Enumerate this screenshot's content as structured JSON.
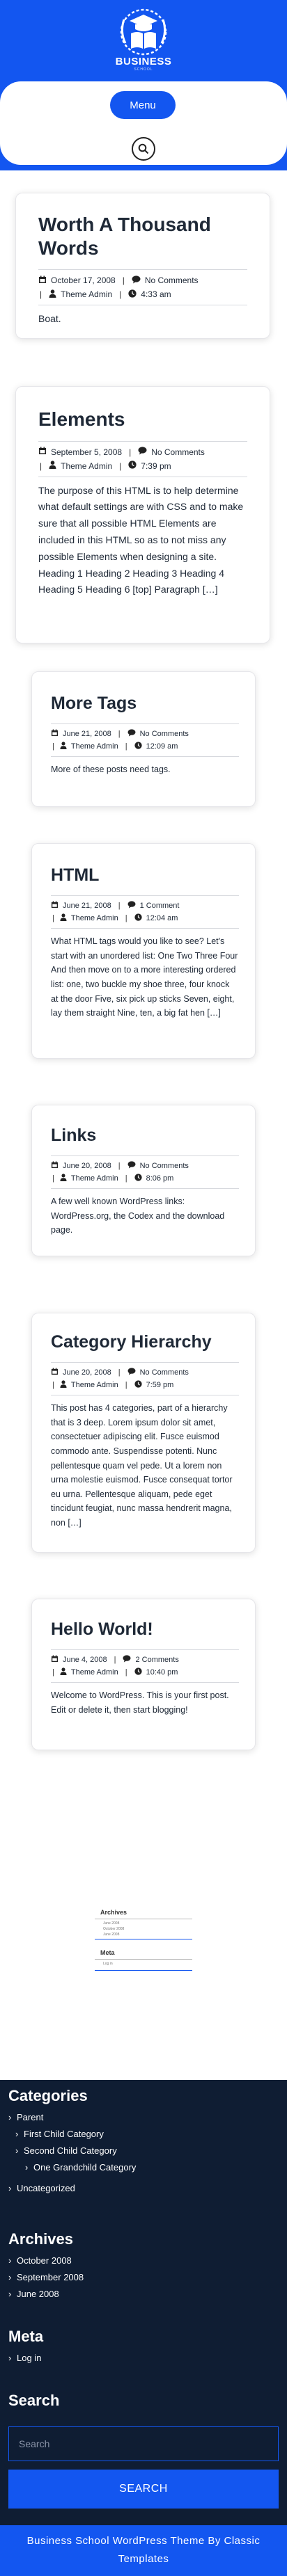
{
  "site": {
    "brand": "BUSINESS",
    "tagline": "SCHOOL"
  },
  "nav": {
    "menu_label": "Menu"
  },
  "posts": [
    {
      "title": "Worth A Thousand Words",
      "date": "October 17, 2008",
      "comments": "No Comments",
      "author": "Theme Admin",
      "time": "4:33 am",
      "excerpt": "Boat."
    },
    {
      "title": "Elements",
      "date": "September 5, 2008",
      "comments": "No Comments",
      "author": "Theme Admin",
      "time": "7:39 pm",
      "excerpt": "The purpose of this HTML is to help determine what default settings are with CSS and to make sure that all possible HTML Elements are included in this HTML so as to not miss any possible Elements when designing a site. Heading 1 Heading 2 Heading 3 Heading 4 Heading 5 Heading 6 [top] Paragraph […]"
    },
    {
      "title": "More Tags",
      "date": "June 21, 2008",
      "comments": "No Comments",
      "author": "Theme Admin",
      "time": "12:09 am",
      "excerpt": "More of these posts need tags."
    },
    {
      "title": "HTML",
      "date": "June 21, 2008",
      "comments": "1 Comment",
      "author": "Theme Admin",
      "time": "12:04 am",
      "excerpt": "What HTML tags would you like to see? Let's start with an unordered list: One Two Three Four And then move on to a more interesting ordered list: one, two buckle my shoe three, four knock at the door Five, six pick up sticks Seven, eight, lay them straight Nine, ten, a big fat hen […]"
    },
    {
      "title": "Links",
      "date": "June 20, 2008",
      "comments": "No Comments",
      "author": "Theme Admin",
      "time": "8:06 pm",
      "excerpt": "A few well known WordPress links: WordPress.org, the Codex and the download page."
    },
    {
      "title": "Category Hierarchy",
      "date": "June 20, 2008",
      "comments": "No Comments",
      "author": "Theme Admin",
      "time": "7:59 pm",
      "excerpt": "This post has 4 categories, part of a hierarchy that is 3 deep. Lorem ipsum dolor sit amet, consectetuer adipiscing elit. Fusce euismod commodo ante. Suspendisse potenti. Nunc pellentesque quam vel pede. Ut a lorem non urna molestie euismod. Fusce consequat tortor eu urna. Pellentesque aliquam, pede eget tincidunt feugiat, nunc massa hendrerit magna, non […]"
    },
    {
      "title": "Hello World!",
      "date": "June 4, 2008",
      "comments": "2 Comments",
      "author": "Theme Admin",
      "time": "10:40 pm",
      "excerpt": "Welcome to WordPress. This is your first post. Edit or delete it, then start blogging!"
    }
  ],
  "mini_widget": {
    "archives_title": "Archives",
    "archives_items": [
      "June 2008",
      "October 2008",
      "June 2008"
    ],
    "meta_title": "Meta",
    "meta_items": [
      "Log in"
    ]
  },
  "footer": {
    "categories_title": "Categories",
    "categories": [
      "Parent",
      "First Child Category",
      "Second Child Category",
      "One Grandchild Category",
      "Uncategorized"
    ],
    "archives_title": "Archives",
    "archives": [
      "October 2008",
      "September 2008",
      "June 2008"
    ],
    "meta_title": "Meta",
    "meta_items": [
      "Log in"
    ],
    "search_title": "Search",
    "search_placeholder": "Search",
    "search_button": "SEARCH"
  },
  "credits": "Business School WordPress Theme By Classic Templates",
  "colors": {
    "primary": "#1356f0",
    "footer_bg": "#0f1d33"
  }
}
